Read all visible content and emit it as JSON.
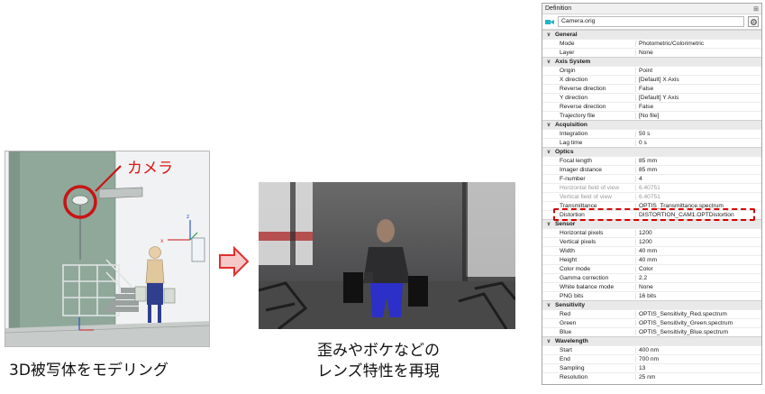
{
  "figures": {
    "camera_label": "カメラ",
    "left_caption": "3D被写体をモデリング",
    "mid_caption_line1": "歪みやボケなどの",
    "mid_caption_line2": "レンズ特性を再現",
    "axis_labels": [
      "z",
      "x",
      "y"
    ]
  },
  "panel": {
    "title": "Definition",
    "pin_icon": "pin-icon",
    "camera_name": "Camera.orig",
    "camera_icon_color": "#1fb5c9",
    "highlight_color": "#d40000",
    "sections": [
      {
        "name": "General",
        "rows": [
          {
            "key": "Mode",
            "value": "Photometric/Colorimetric"
          },
          {
            "key": "Layer",
            "value": "None"
          }
        ]
      },
      {
        "name": "Axis System",
        "rows": [
          {
            "key": "Origin",
            "value": "Point"
          },
          {
            "key": "X direction",
            "value": "[Default] X Axis"
          },
          {
            "key": "Reverse direction",
            "value": "False"
          },
          {
            "key": "Y direction",
            "value": "[Default] Y Axis"
          },
          {
            "key": "Reverse direction",
            "value": "False"
          },
          {
            "key": "Trajectory file",
            "value": "[No file]"
          }
        ]
      },
      {
        "name": "Acquisition",
        "rows": [
          {
            "key": "Integration",
            "value": "50 s"
          },
          {
            "key": "Lag time",
            "value": "0 s"
          }
        ]
      },
      {
        "name": "Optics",
        "rows": [
          {
            "key": "Focal length",
            "value": "85 mm"
          },
          {
            "key": "Imager distance",
            "value": "85 mm"
          },
          {
            "key": "F-number",
            "value": "4"
          },
          {
            "key": "Horizontal field of view",
            "value": "6.40751",
            "dim": true
          },
          {
            "key": "Vertical field of view",
            "value": "6.40751",
            "dim": true
          },
          {
            "key": "Transmittance",
            "value": "OPTIS_Transmittance.spectrum"
          },
          {
            "key": "Distortion",
            "value": "DISTORTION_CAM1.OPTDistortion",
            "highlight": true
          }
        ]
      },
      {
        "name": "Sensor",
        "rows": [
          {
            "key": "Horizontal pixels",
            "value": "1200"
          },
          {
            "key": "Vertical pixels",
            "value": "1200"
          },
          {
            "key": "Width",
            "value": "40 mm"
          },
          {
            "key": "Height",
            "value": "40 mm"
          },
          {
            "key": "Color mode",
            "value": "Color"
          },
          {
            "key": "Gamma correction",
            "value": "2.2"
          },
          {
            "key": "White balance mode",
            "value": "None"
          },
          {
            "key": "PNG bits",
            "value": "16 bits"
          }
        ]
      },
      {
        "name": "Sensitivity",
        "rows": [
          {
            "key": "Red",
            "value": "OPTIS_Sensitivity_Red.spectrum"
          },
          {
            "key": "Green",
            "value": "OPTIS_Sensitivity_Green.spectrum"
          },
          {
            "key": "Blue",
            "value": "OPTIS_Sensitivity_Blue.spectrum"
          }
        ]
      },
      {
        "name": "Wavelength",
        "rows": [
          {
            "key": "Start",
            "value": "400 nm"
          },
          {
            "key": "End",
            "value": "700 nm"
          },
          {
            "key": "Sampling",
            "value": "13"
          },
          {
            "key": "Resolution",
            "value": "25 nm"
          }
        ]
      }
    ]
  }
}
